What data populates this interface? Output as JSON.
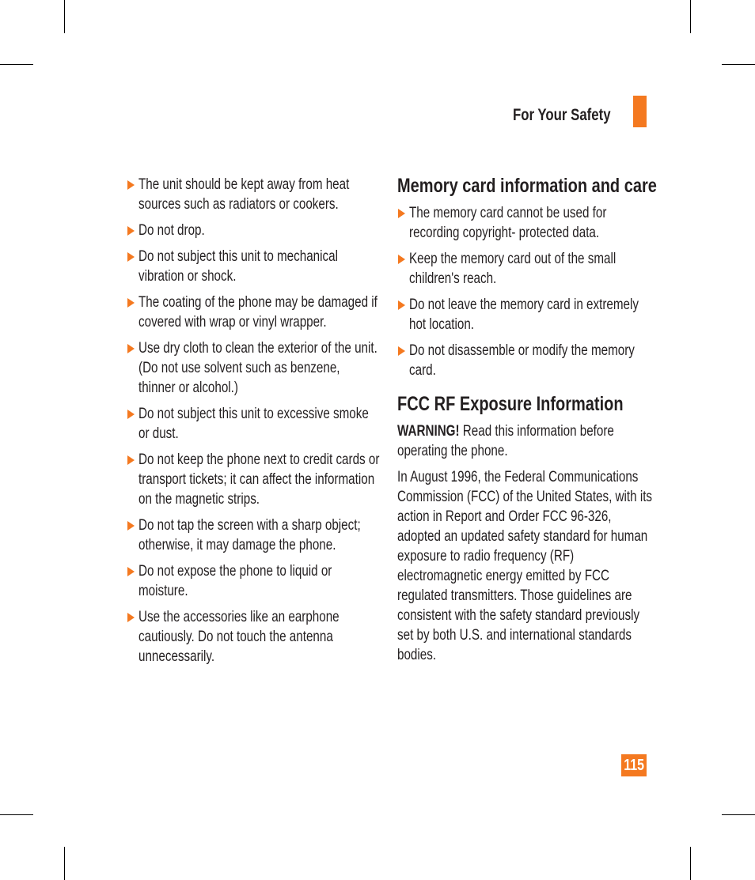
{
  "header": {
    "title": "For Your Safety",
    "accent_color": "#f47920"
  },
  "left_column": {
    "bullets": [
      "The unit should be kept away from heat sources such as radiators or cookers.",
      "Do not drop.",
      "Do not subject this unit to mechanical vibration or shock.",
      "The coating of the phone may be damaged if covered with wrap or vinyl wrapper.",
      "Use dry cloth to clean the exterior of the unit. (Do not use solvent such as benzene, thinner or alcohol.)",
      "Do not subject this unit to excessive smoke or dust.",
      "Do not keep the phone next to credit cards or transport tickets; it can affect the information on the magnetic strips.",
      "Do not tap the screen with a sharp object; otherwise, it may damage the phone.",
      "Do not expose the phone to liquid or moisture.",
      "Use the accessories like an earphone cautiously. Do not touch the antenna unnecessarily."
    ]
  },
  "memory_section": {
    "heading": "Memory card information and care",
    "bullets": [
      "The memory card cannot be used for recording copyright- protected data.",
      "Keep the memory card out of the small children's reach.",
      "Do not leave the memory card in extremely hot location.",
      "Do not disassemble or modify the memory card."
    ]
  },
  "fcc_section": {
    "heading": "FCC RF Exposure Information",
    "warning_label": "WARNING!",
    "warning_text": " Read this information before operating the phone.",
    "paragraph": "In August 1996, the Federal Communications Commission (FCC) of the United States, with its action in Report and Order FCC 96-326, adopted an updated safety standard for human exposure to radio frequency (RF) electromagnetic energy emitted by FCC regulated transmitters. Those guidelines are consistent with the safety standard previously set by both U.S. and international standards bodies."
  },
  "page_number": "115"
}
